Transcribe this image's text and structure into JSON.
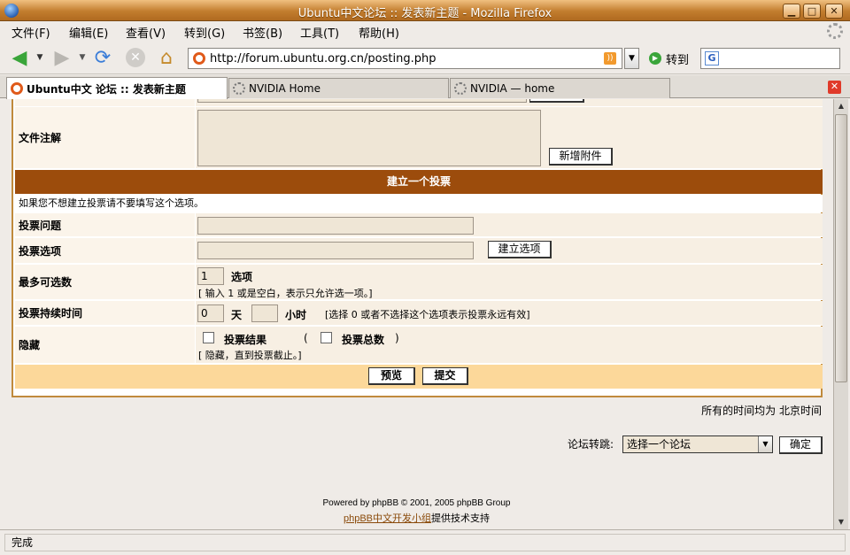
{
  "window": {
    "title": "Ubuntu中文论坛 :: 发表新主题 - Mozilla Firefox"
  },
  "menu": [
    "文件(F)",
    "编辑(E)",
    "查看(V)",
    "转到(G)",
    "书签(B)",
    "工具(T)",
    "帮助(H)"
  ],
  "toolbar": {
    "url": "http://forum.ubuntu.org.cn/posting.php",
    "go_label": "转到",
    "search_value": ""
  },
  "tabs": [
    {
      "label": "Ubuntu中文 论坛 :: 发表新主题",
      "active": true
    },
    {
      "label": "NVIDIA Home",
      "active": false
    },
    {
      "label": "NVIDIA — home",
      "active": false
    }
  ],
  "form": {
    "file_comment_label": "文件注解",
    "add_attachment_label": "新增附件",
    "poll_header": "建立一个投票",
    "poll_note": "如果您不想建立投票请不要填写这个选项。",
    "poll_question_label": "投票问题",
    "poll_option_label": "投票选项",
    "add_option_label": "建立选项",
    "max_choices_label": "最多可选数",
    "max_choices_value": "1",
    "max_choices_unit": "选项",
    "max_choices_hint": "[ 输入 1 或是空白，表示只允许选一项。]",
    "duration_label": "投票持续时间",
    "duration_days": "0",
    "duration_days_unit": "天",
    "duration_hours": "",
    "duration_hours_unit": "小时",
    "duration_hint": "[选择 0 或者不选择这个选项表示投票永远有效]",
    "hide_label": "隐藏",
    "hide_results_label": "投票结果",
    "hide_open_paren": "(",
    "hide_total_label": "投票总数",
    "hide_close_paren": ")",
    "hide_hint": "[ 隐藏，直到投票截止。]",
    "preview_label": "预览",
    "submit_label": "提交"
  },
  "page": {
    "timezone_note": "所有的时间均为 北京时间",
    "jump_label": "论坛转跳:",
    "jump_selected": "选择一个论坛",
    "jump_confirm": "确定",
    "powered_by": "Powered by phpBB © 2001, 2005 phpBB Group",
    "translation_link": "phpBB中文开发小组",
    "translation_suffix": "提供技术支持"
  },
  "status": {
    "text": "完成"
  }
}
